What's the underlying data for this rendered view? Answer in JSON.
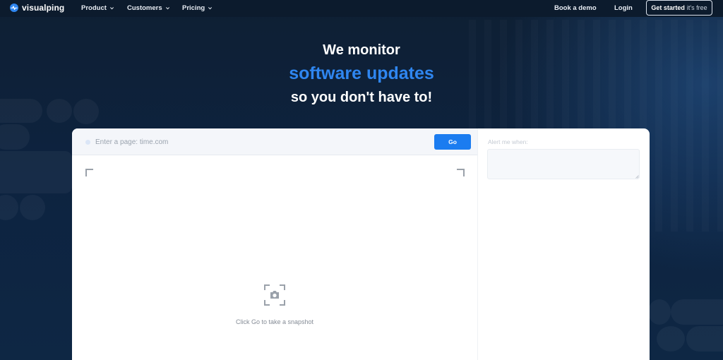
{
  "nav": {
    "logo": "visualping",
    "items": [
      {
        "label": "Product"
      },
      {
        "label": "Customers"
      },
      {
        "label": "Pricing"
      }
    ],
    "book_demo": "Book a demo",
    "login": "Login",
    "get_started_bold": "Get started",
    "get_started_light": "it's free"
  },
  "hero": {
    "line1": "We monitor",
    "line2": "software updates",
    "line3": "so you don't have to!"
  },
  "panel": {
    "url_placeholder": "Enter a page: time.com",
    "url_value": "",
    "go_label": "Go",
    "snapshot_text": "Click Go to take a snapshot",
    "alert_label": "Alert me when:",
    "alert_value": ""
  },
  "colors": {
    "accent": "#1b7cf0",
    "headline_blue": "#2f86f0",
    "background": "#0d2238"
  }
}
